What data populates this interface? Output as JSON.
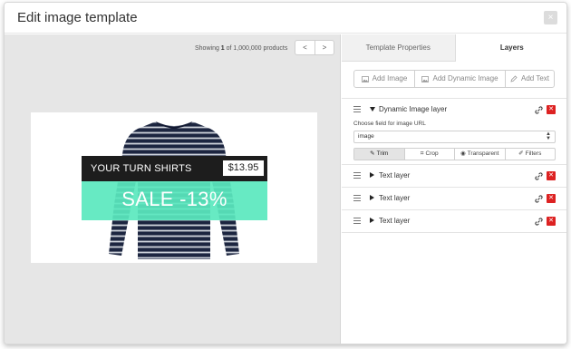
{
  "modal": {
    "title": "Edit image template",
    "close_label": "×"
  },
  "pager": {
    "prefix": "Showing ",
    "current": "1",
    "suffix": " of 1,000,000 products",
    "prev_label": "<",
    "next_label": ">"
  },
  "preview": {
    "name_text": "YOUR TURN SHIRTS",
    "price_text": "$13.95",
    "sale_text": "SALE -13%"
  },
  "tabs": [
    {
      "label": "Template Properties",
      "active": false
    },
    {
      "label": "Layers",
      "active": true
    }
  ],
  "add_buttons": [
    {
      "label": "Add Image",
      "icon": "image-icon"
    },
    {
      "label": "Add Dynamic Image",
      "icon": "image-icon"
    },
    {
      "label": "Add Text",
      "icon": "pencil-icon"
    }
  ],
  "layers": [
    {
      "name": "Dynamic Image layer",
      "expanded": true,
      "field_label": "Choose field for image URL",
      "field_value": "image",
      "options": [
        {
          "label": "Trim",
          "icon": "pencil-icon",
          "active": true
        },
        {
          "label": "Crop",
          "icon": "crop-icon",
          "active": false
        },
        {
          "label": "Transparent",
          "icon": "eye-icon",
          "active": false
        },
        {
          "label": "Filters",
          "icon": "brush-icon",
          "active": false
        }
      ]
    },
    {
      "name": "Text layer",
      "expanded": false
    },
    {
      "name": "Text layer",
      "expanded": false
    },
    {
      "name": "Text layer",
      "expanded": false
    }
  ],
  "colors": {
    "sale_band": "#5ae8be",
    "delete": "#dd2222",
    "name_band": "#1d1d1d"
  }
}
